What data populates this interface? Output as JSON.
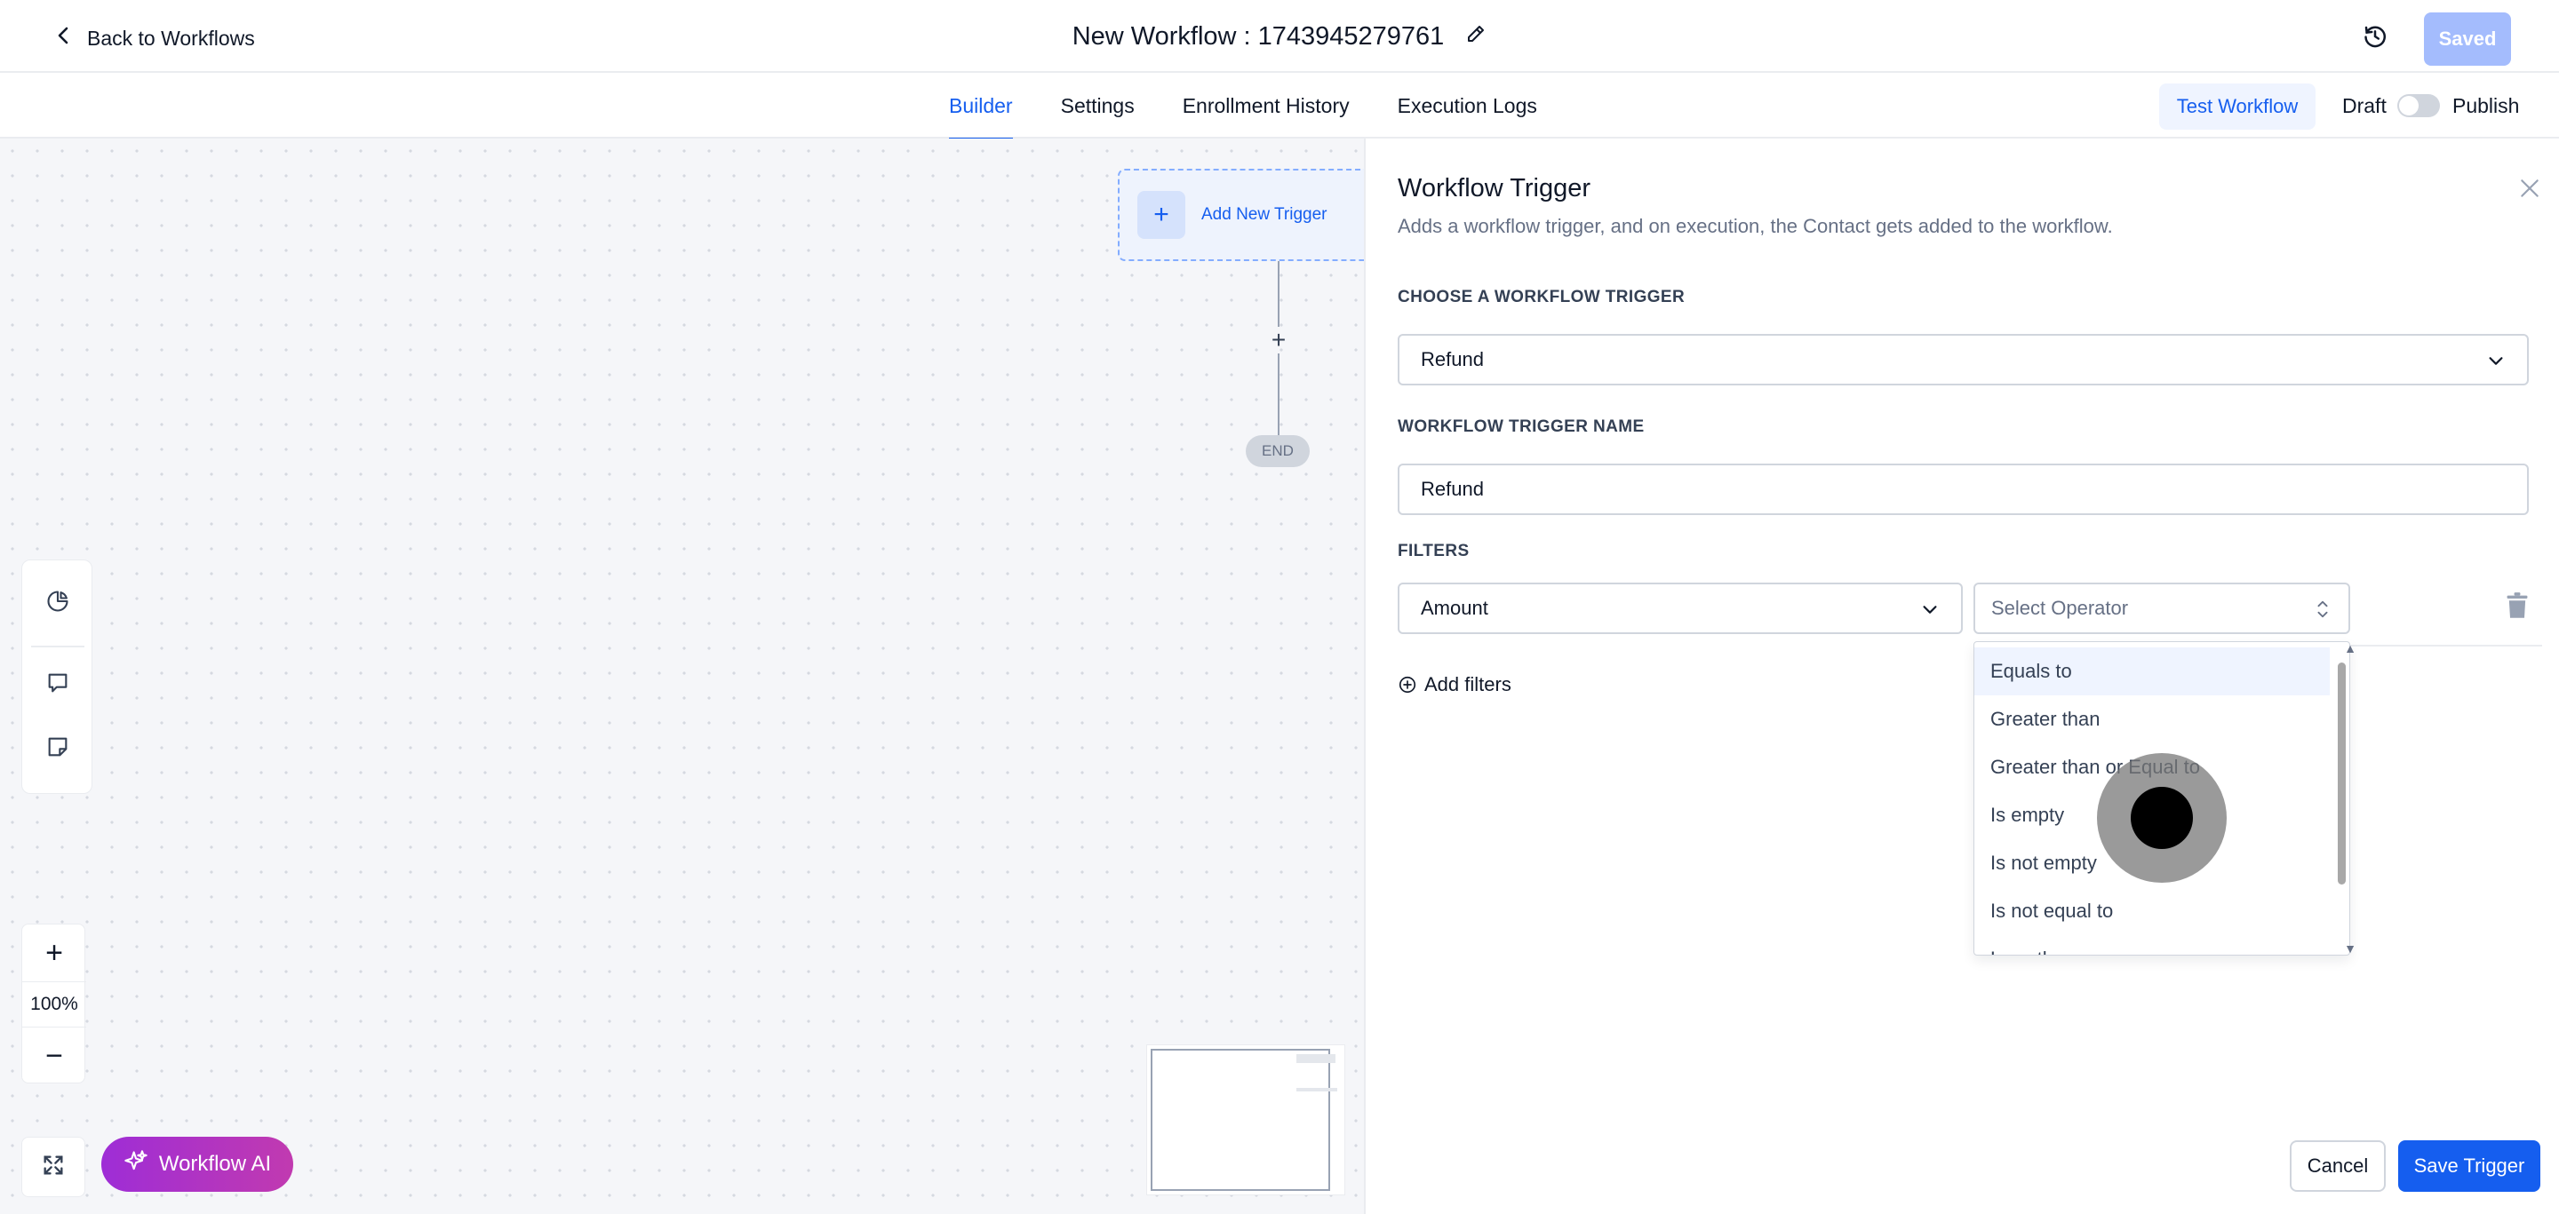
{
  "header": {
    "back_label": "Back to Workflows",
    "workflow_title": "New Workflow : 1743945279761",
    "saved_label": "Saved"
  },
  "tabs": [
    {
      "label": "Builder",
      "active": true
    },
    {
      "label": "Settings",
      "active": false
    },
    {
      "label": "Enrollment History",
      "active": false
    },
    {
      "label": "Execution Logs",
      "active": false
    }
  ],
  "actions": {
    "test_label": "Test Workflow",
    "draft_label": "Draft",
    "publish_label": "Publish",
    "published": false
  },
  "canvas": {
    "trigger_node_label": "Add New Trigger",
    "end_label": "END",
    "zoom_level": "100%",
    "ai_label": "Workflow AI"
  },
  "panel": {
    "title": "Workflow Trigger",
    "subtitle": "Adds a workflow trigger, and on execution, the Contact gets added to the workflow.",
    "choose_trigger_label": "CHOOSE A WORKFLOW TRIGGER",
    "trigger_value": "Refund",
    "trigger_name_label": "WORKFLOW TRIGGER NAME",
    "trigger_name_value": "Refund",
    "filters_label": "FILTERS",
    "filter_field_value": "Amount",
    "operator_placeholder": "Select Operator",
    "operator_options": [
      "Equals to",
      "Greater than",
      "Greater than or Equal to",
      "Is empty",
      "Is not empty",
      "Is not equal to",
      "Less than"
    ],
    "highlighted_option": 0,
    "add_filters_label": "Add filters",
    "cancel_label": "Cancel",
    "save_label": "Save Trigger"
  },
  "colors": {
    "primary": "#155eef",
    "saved_disabled": "#a4bcfd",
    "ai_gradient_start": "#9e2dd6",
    "ai_gradient_end": "#c13ab0"
  }
}
